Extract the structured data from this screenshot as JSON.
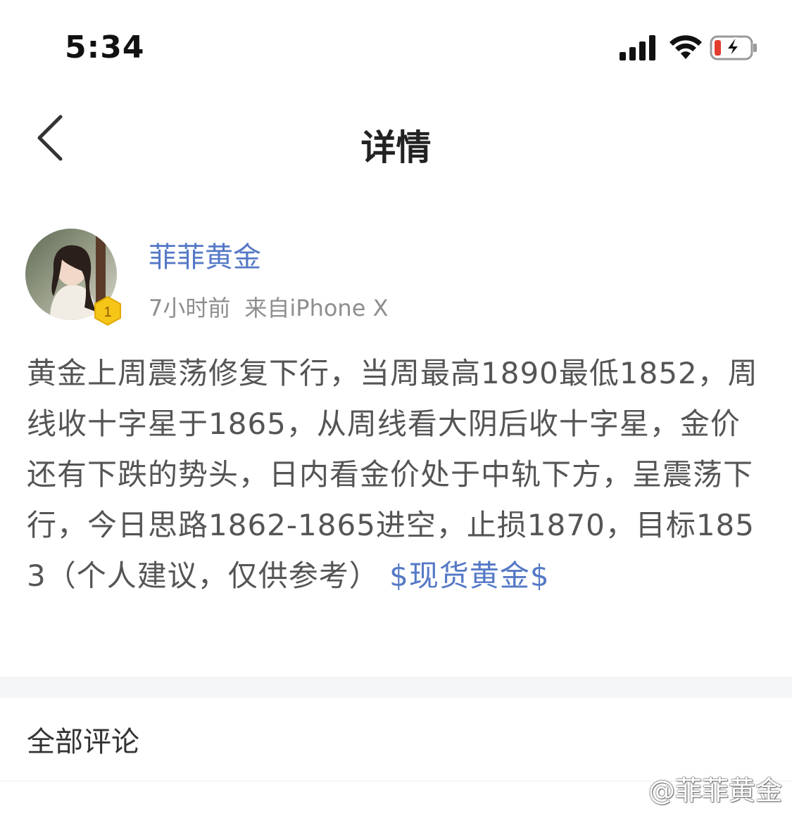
{
  "status_bar": {
    "time": "5:34",
    "icons": [
      "signal-icon",
      "wifi-icon",
      "battery-charging-icon"
    ],
    "battery_color": "#e33b2e"
  },
  "nav": {
    "title": "详情",
    "back_icon": "chevron-left-icon"
  },
  "post": {
    "author": {
      "name": "菲菲黄金",
      "level": "1",
      "time": "7小时前",
      "source": "来自iPhone X"
    },
    "body": "黄金上周震荡修复下行，当周最高1890最低1852，周线收十字星于1865，从周线看大阴后收十字星，金价还有下跌的势头，日内看金价处于中轨下方，呈震荡下行，今日思路1862-1865进空，止损1870，目标1853（个人建议，仅供参考）",
    "topic": "$现货黄金$"
  },
  "comments": {
    "header": "全部评论"
  },
  "watermark": "@菲菲黄金",
  "colors": {
    "link": "#5579c6",
    "body_text": "#555555",
    "meta_text": "#8e8e8e",
    "divider": "#f4f5f7",
    "badge": "#f5c518"
  }
}
